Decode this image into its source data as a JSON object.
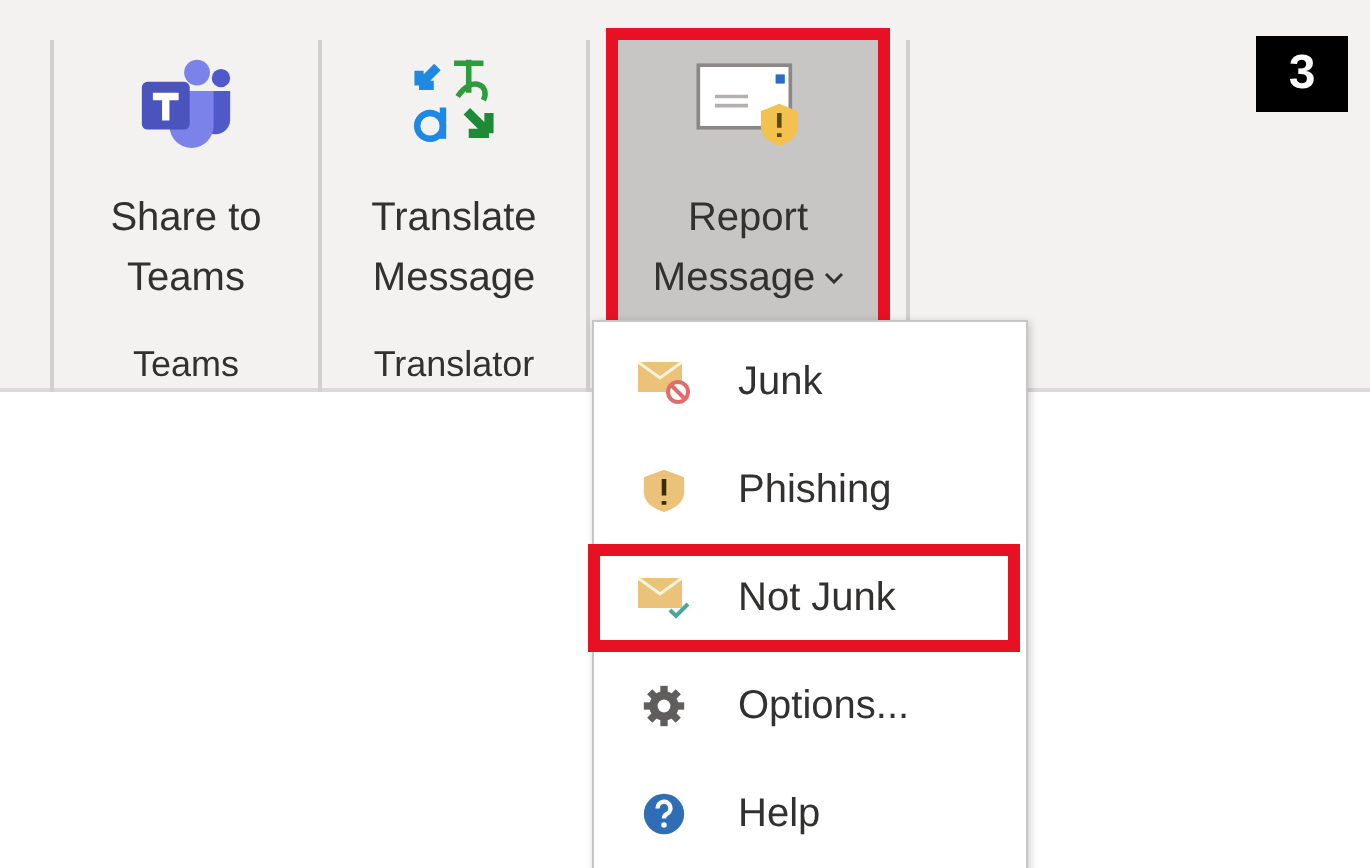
{
  "ribbon": {
    "groups": [
      {
        "label": "Teams",
        "buttons": [
          {
            "kind": "teams",
            "lines": [
              "Share to",
              "Teams"
            ],
            "selected": false,
            "highlighted": false,
            "dropdown": false
          }
        ]
      },
      {
        "label": "Translator",
        "buttons": [
          {
            "kind": "translate",
            "lines": [
              "Translate",
              "Message"
            ],
            "selected": false,
            "highlighted": false,
            "dropdown": false
          }
        ]
      },
      {
        "buttons": [
          {
            "kind": "report",
            "lines": [
              "Report",
              "Message"
            ],
            "selected": true,
            "highlighted": true,
            "dropdown": true
          }
        ]
      }
    ]
  },
  "menu": {
    "items": [
      {
        "kind": "junk",
        "label": "Junk",
        "highlighted": false
      },
      {
        "kind": "phishing",
        "label": "Phishing",
        "highlighted": false
      },
      {
        "kind": "not-junk",
        "label": "Not Junk",
        "highlighted": true
      },
      {
        "kind": "options",
        "label": "Options...",
        "highlighted": false
      },
      {
        "kind": "help",
        "label": "Help",
        "highlighted": false
      }
    ]
  },
  "step_badge": "3"
}
